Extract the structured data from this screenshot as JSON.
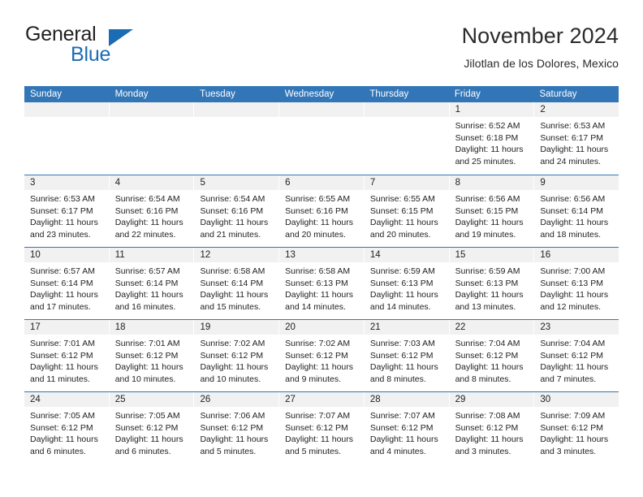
{
  "brand": {
    "name_part1": "General",
    "name_part2": "Blue",
    "triangle_color": "#1a6cb3",
    "text_color": "#231f20"
  },
  "header": {
    "title": "November 2024",
    "subtitle": "Jilotlan de los Dolores, Mexico"
  },
  "theme": {
    "header_blue": "#3276b8",
    "date_band_gray": "#f1f1f1",
    "text": "#222222",
    "white": "#ffffff"
  },
  "calendar": {
    "weekday_headers": [
      "Sunday",
      "Monday",
      "Tuesday",
      "Wednesday",
      "Thursday",
      "Friday",
      "Saturday"
    ],
    "weeks": [
      [
        {
          "day": "",
          "empty": true
        },
        {
          "day": "",
          "empty": true
        },
        {
          "day": "",
          "empty": true
        },
        {
          "day": "",
          "empty": true
        },
        {
          "day": "",
          "empty": true
        },
        {
          "day": "1",
          "sunrise": "Sunrise: 6:52 AM",
          "sunset": "Sunset: 6:18 PM",
          "daylight1": "Daylight: 11 hours",
          "daylight2": "and 25 minutes."
        },
        {
          "day": "2",
          "sunrise": "Sunrise: 6:53 AM",
          "sunset": "Sunset: 6:17 PM",
          "daylight1": "Daylight: 11 hours",
          "daylight2": "and 24 minutes."
        }
      ],
      [
        {
          "day": "3",
          "sunrise": "Sunrise: 6:53 AM",
          "sunset": "Sunset: 6:17 PM",
          "daylight1": "Daylight: 11 hours",
          "daylight2": "and 23 minutes."
        },
        {
          "day": "4",
          "sunrise": "Sunrise: 6:54 AM",
          "sunset": "Sunset: 6:16 PM",
          "daylight1": "Daylight: 11 hours",
          "daylight2": "and 22 minutes."
        },
        {
          "day": "5",
          "sunrise": "Sunrise: 6:54 AM",
          "sunset": "Sunset: 6:16 PM",
          "daylight1": "Daylight: 11 hours",
          "daylight2": "and 21 minutes."
        },
        {
          "day": "6",
          "sunrise": "Sunrise: 6:55 AM",
          "sunset": "Sunset: 6:16 PM",
          "daylight1": "Daylight: 11 hours",
          "daylight2": "and 20 minutes."
        },
        {
          "day": "7",
          "sunrise": "Sunrise: 6:55 AM",
          "sunset": "Sunset: 6:15 PM",
          "daylight1": "Daylight: 11 hours",
          "daylight2": "and 20 minutes."
        },
        {
          "day": "8",
          "sunrise": "Sunrise: 6:56 AM",
          "sunset": "Sunset: 6:15 PM",
          "daylight1": "Daylight: 11 hours",
          "daylight2": "and 19 minutes."
        },
        {
          "day": "9",
          "sunrise": "Sunrise: 6:56 AM",
          "sunset": "Sunset: 6:14 PM",
          "daylight1": "Daylight: 11 hours",
          "daylight2": "and 18 minutes."
        }
      ],
      [
        {
          "day": "10",
          "sunrise": "Sunrise: 6:57 AM",
          "sunset": "Sunset: 6:14 PM",
          "daylight1": "Daylight: 11 hours",
          "daylight2": "and 17 minutes."
        },
        {
          "day": "11",
          "sunrise": "Sunrise: 6:57 AM",
          "sunset": "Sunset: 6:14 PM",
          "daylight1": "Daylight: 11 hours",
          "daylight2": "and 16 minutes."
        },
        {
          "day": "12",
          "sunrise": "Sunrise: 6:58 AM",
          "sunset": "Sunset: 6:14 PM",
          "daylight1": "Daylight: 11 hours",
          "daylight2": "and 15 minutes."
        },
        {
          "day": "13",
          "sunrise": "Sunrise: 6:58 AM",
          "sunset": "Sunset: 6:13 PM",
          "daylight1": "Daylight: 11 hours",
          "daylight2": "and 14 minutes."
        },
        {
          "day": "14",
          "sunrise": "Sunrise: 6:59 AM",
          "sunset": "Sunset: 6:13 PM",
          "daylight1": "Daylight: 11 hours",
          "daylight2": "and 14 minutes."
        },
        {
          "day": "15",
          "sunrise": "Sunrise: 6:59 AM",
          "sunset": "Sunset: 6:13 PM",
          "daylight1": "Daylight: 11 hours",
          "daylight2": "and 13 minutes."
        },
        {
          "day": "16",
          "sunrise": "Sunrise: 7:00 AM",
          "sunset": "Sunset: 6:13 PM",
          "daylight1": "Daylight: 11 hours",
          "daylight2": "and 12 minutes."
        }
      ],
      [
        {
          "day": "17",
          "sunrise": "Sunrise: 7:01 AM",
          "sunset": "Sunset: 6:12 PM",
          "daylight1": "Daylight: 11 hours",
          "daylight2": "and 11 minutes."
        },
        {
          "day": "18",
          "sunrise": "Sunrise: 7:01 AM",
          "sunset": "Sunset: 6:12 PM",
          "daylight1": "Daylight: 11 hours",
          "daylight2": "and 10 minutes."
        },
        {
          "day": "19",
          "sunrise": "Sunrise: 7:02 AM",
          "sunset": "Sunset: 6:12 PM",
          "daylight1": "Daylight: 11 hours",
          "daylight2": "and 10 minutes."
        },
        {
          "day": "20",
          "sunrise": "Sunrise: 7:02 AM",
          "sunset": "Sunset: 6:12 PM",
          "daylight1": "Daylight: 11 hours",
          "daylight2": "and 9 minutes."
        },
        {
          "day": "21",
          "sunrise": "Sunrise: 7:03 AM",
          "sunset": "Sunset: 6:12 PM",
          "daylight1": "Daylight: 11 hours",
          "daylight2": "and 8 minutes."
        },
        {
          "day": "22",
          "sunrise": "Sunrise: 7:04 AM",
          "sunset": "Sunset: 6:12 PM",
          "daylight1": "Daylight: 11 hours",
          "daylight2": "and 8 minutes."
        },
        {
          "day": "23",
          "sunrise": "Sunrise: 7:04 AM",
          "sunset": "Sunset: 6:12 PM",
          "daylight1": "Daylight: 11 hours",
          "daylight2": "and 7 minutes."
        }
      ],
      [
        {
          "day": "24",
          "sunrise": "Sunrise: 7:05 AM",
          "sunset": "Sunset: 6:12 PM",
          "daylight1": "Daylight: 11 hours",
          "daylight2": "and 6 minutes."
        },
        {
          "day": "25",
          "sunrise": "Sunrise: 7:05 AM",
          "sunset": "Sunset: 6:12 PM",
          "daylight1": "Daylight: 11 hours",
          "daylight2": "and 6 minutes."
        },
        {
          "day": "26",
          "sunrise": "Sunrise: 7:06 AM",
          "sunset": "Sunset: 6:12 PM",
          "daylight1": "Daylight: 11 hours",
          "daylight2": "and 5 minutes."
        },
        {
          "day": "27",
          "sunrise": "Sunrise: 7:07 AM",
          "sunset": "Sunset: 6:12 PM",
          "daylight1": "Daylight: 11 hours",
          "daylight2": "and 5 minutes."
        },
        {
          "day": "28",
          "sunrise": "Sunrise: 7:07 AM",
          "sunset": "Sunset: 6:12 PM",
          "daylight1": "Daylight: 11 hours",
          "daylight2": "and 4 minutes."
        },
        {
          "day": "29",
          "sunrise": "Sunrise: 7:08 AM",
          "sunset": "Sunset: 6:12 PM",
          "daylight1": "Daylight: 11 hours",
          "daylight2": "and 3 minutes."
        },
        {
          "day": "30",
          "sunrise": "Sunrise: 7:09 AM",
          "sunset": "Sunset: 6:12 PM",
          "daylight1": "Daylight: 11 hours",
          "daylight2": "and 3 minutes."
        }
      ]
    ]
  }
}
